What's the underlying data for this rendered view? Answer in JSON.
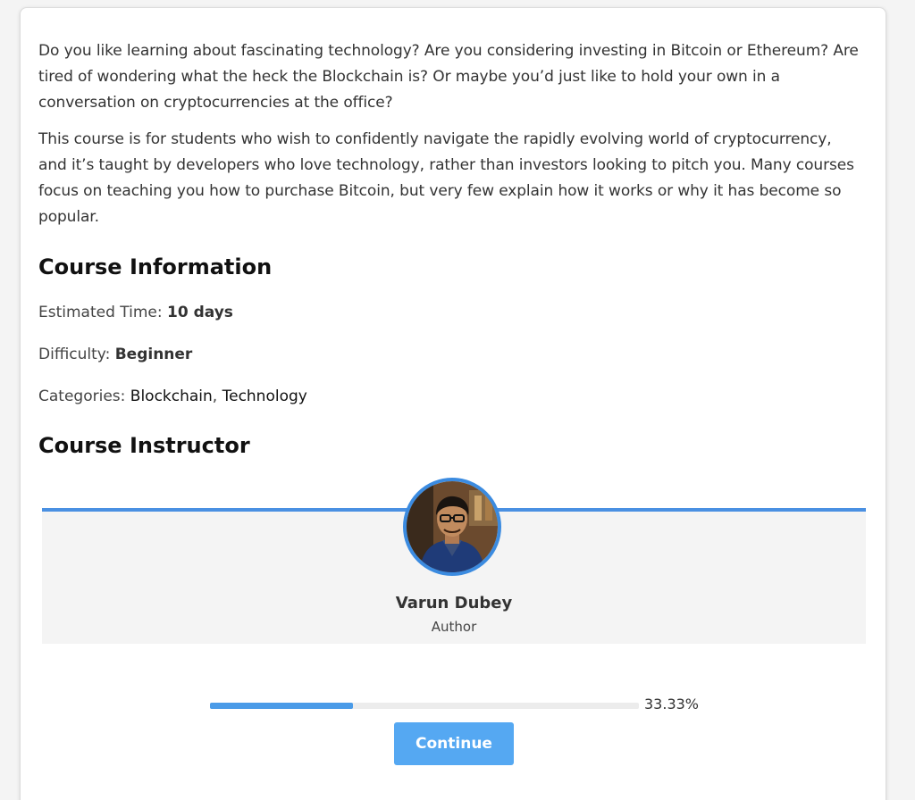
{
  "description": {
    "paragraphs": [
      "Do you like learning about fascinating technology? Are you considering investing in Bitcoin or Ethereum? Are tired of wondering what the heck the Blockchain is? Or maybe you’d just like to hold your own in a conversation on cryptocurrencies at the office?",
      "This course is for students who wish to confidently navigate the rapidly evolving world of cryptocurrency, and it’s taught by developers who love technology, rather than investors looking to pitch you. Many courses focus on teaching you how to purchase Bitcoin, but very few explain how it works or why it has become so popular."
    ]
  },
  "course_info": {
    "heading": "Course Information",
    "estimated_time_label": "Estimated Time:",
    "estimated_time_value": "10 days",
    "difficulty_label": "Difficulty:",
    "difficulty_value": "Beginner",
    "categories_label": "Categories:",
    "categories": [
      "Blockchain",
      "Technology"
    ],
    "categories_separator": ", "
  },
  "instructor": {
    "heading": "Course Instructor",
    "name": "Varun Dubey",
    "role": "Author",
    "accent_color": "#4a90e2"
  },
  "progress": {
    "percent": 33.33,
    "label": "33.33%",
    "fill_color": "#4a9be8"
  },
  "actions": {
    "continue_label": "Continue",
    "continue_color": "#55a8f2"
  }
}
